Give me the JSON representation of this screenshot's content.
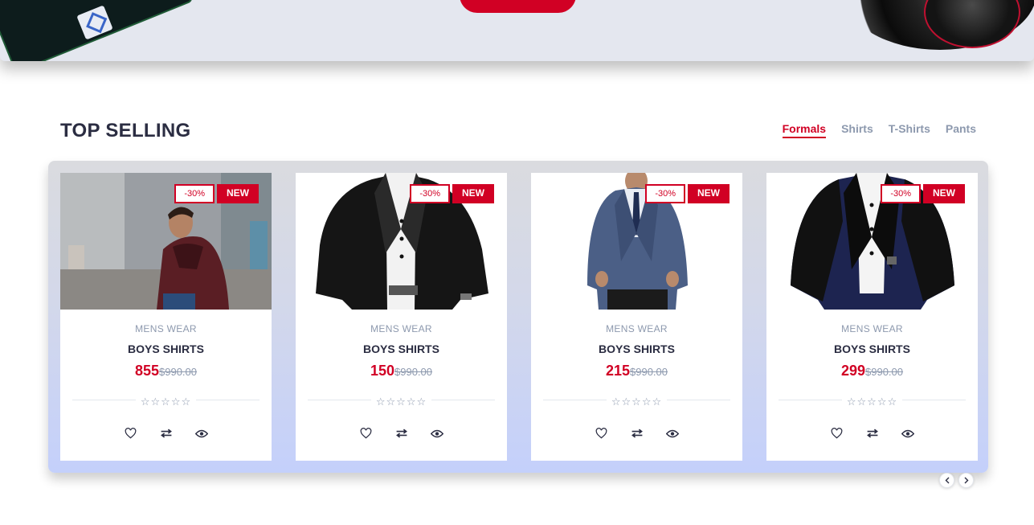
{
  "section": {
    "title": "TOP SELLING"
  },
  "tabs": [
    {
      "label": "Formals",
      "active": true
    },
    {
      "label": "Shirts",
      "active": false
    },
    {
      "label": "T-Shirts",
      "active": false
    },
    {
      "label": "Pants",
      "active": false
    }
  ],
  "products": [
    {
      "sale": "-30%",
      "new": "NEW",
      "category": "MENS WEAR",
      "name": "BOYS SHIRTS",
      "price": "855",
      "old_price": "$990.00",
      "rating": 0,
      "image": "man-maroon-jacket-photo"
    },
    {
      "sale": "-30%",
      "new": "NEW",
      "category": "MENS WEAR",
      "name": "BOYS SHIRTS",
      "price": "150",
      "old_price": "$990.00",
      "rating": 0,
      "image": "black-blazer-photo"
    },
    {
      "sale": "-30%",
      "new": "NEW",
      "category": "MENS WEAR",
      "name": "BOYS SHIRTS",
      "price": "215",
      "old_price": "$990.00",
      "rating": 0,
      "image": "grey-blue-suit-photo"
    },
    {
      "sale": "-30%",
      "new": "NEW",
      "category": "MENS WEAR",
      "name": "BOYS SHIRTS",
      "price": "299",
      "old_price": "$990.00",
      "rating": 0,
      "image": "navy-blazer-photo"
    }
  ],
  "rating_stars": "☆☆☆☆☆",
  "icons": {
    "wishlist": "heart-icon",
    "compare": "exchange-icon",
    "quick_view": "eye-icon",
    "prev": "chevron-left-icon",
    "next": "chevron-right-icon"
  },
  "colors": {
    "accent": "#d10024",
    "heading": "#2b2d42",
    "muted": "#8d99ae",
    "hero_bg": "#e4e7ef"
  }
}
